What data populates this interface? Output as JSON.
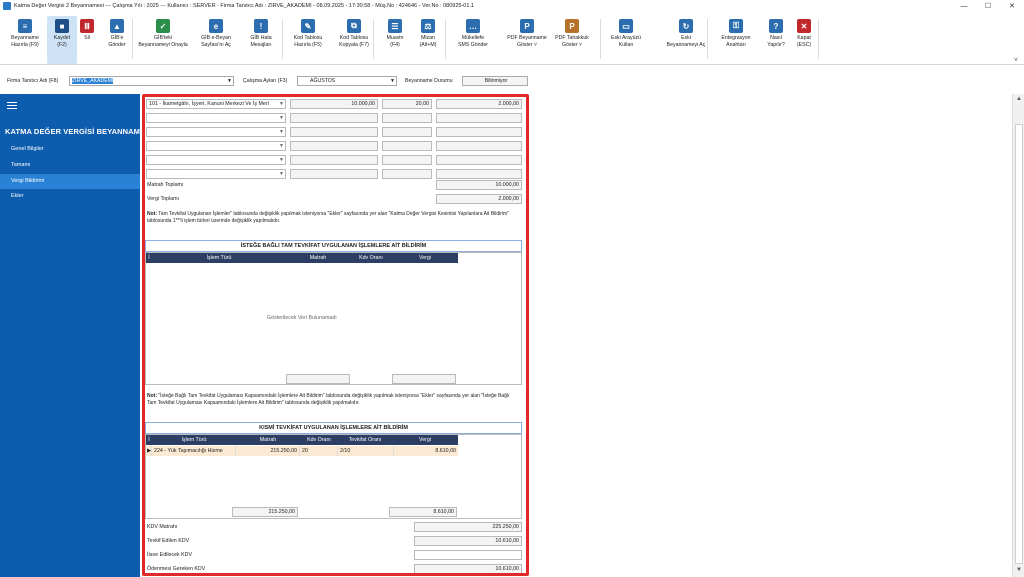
{
  "window": {
    "title": "Katma Değer Vergisi 2 Beyannamesi  ---  Çalışma Yılı : 2025  ---  Kullanıcı : SERVER - Firma Tanıtıcı Adı : ZIRVE_AKADEMI - 08.09.2025 - 17:30:58 - Müş.No : 424646 - Ver.No : 080925-01.1",
    "minimize": "—",
    "maximize": "☐",
    "close": "✕"
  },
  "toolbar": {
    "buttons": [
      {
        "label": "Beyanname\nHazırla (F9)",
        "color": "#2c6db0",
        "glyph": "≡"
      },
      {
        "label": "Kaydet\n(F2)",
        "color": "#1d4f86",
        "glyph": "■"
      },
      {
        "label": "Sil",
        "color": "#c0282d",
        "glyph": "Ⅲ"
      },
      {
        "label": "GİB'e\nGönder",
        "color": "#2c6db0",
        "glyph": "▲"
      },
      {
        "label": "GİB'teki\nBeyannameyi Onayla",
        "color": "#2b8f4b",
        "glyph": "✓"
      },
      {
        "label": "GİB e-Beyan\nSayfası'nı Aç",
        "color": "#2c6db0",
        "glyph": "e"
      },
      {
        "label": "GİB Hata\nMesajları",
        "color": "#2c6db0",
        "glyph": "!"
      },
      {
        "label": "Kod Tablosu\nHazırla (F5)",
        "color": "#2c6db0",
        "glyph": "✎"
      },
      {
        "label": "Kod Tablosu\nKopyala (F7)",
        "color": "#2c6db0",
        "glyph": "⧉"
      },
      {
        "label": "Muavin\n(F4)",
        "color": "#2c6db0",
        "glyph": "☰"
      },
      {
        "label": "Mizan\n(Alt+M)",
        "color": "#2c6db0",
        "glyph": "⚖"
      },
      {
        "label": "Mükellefe\nSMS Gönder",
        "color": "#2c6db0",
        "glyph": "…"
      },
      {
        "label": "PDF Beyanname\nGöster ˅",
        "color": "#2c6db0",
        "glyph": "P"
      },
      {
        "label": "PDF Tahakkuk\nGöster ˅",
        "color": "#b5702a",
        "glyph": "P"
      },
      {
        "label": "Eski Arayüzü\nKullan",
        "color": "#2c6db0",
        "glyph": "▭"
      },
      {
        "label": "Eski\nBeyannameyi Aç",
        "color": "#2c6db0",
        "glyph": "↻"
      },
      {
        "label": "Entegrasyon\nAnahtarı",
        "color": "#2c6db0",
        "glyph": "⚿"
      },
      {
        "label": "Nasıl\nYapılır?",
        "color": "#2c6db0",
        "glyph": "?"
      },
      {
        "label": "Kapat\n(ESC)",
        "color": "#c0282d",
        "glyph": "✕"
      }
    ],
    "collapse": "˅"
  },
  "filters": {
    "firma_label": "Firma Tanıtıcı Adı (F8)",
    "firma_value": "ZIRVE_AKADEMI",
    "ay_label": "Çalışma Ayları (F3)",
    "ay_value": "AĞUSTOS",
    "durum_label": "Beyanname Durumu",
    "durum_value": "Bilinmiyor"
  },
  "sidebar": {
    "title": "KATMA  DEĞER VERGİSİ BEYANNAM...",
    "items": [
      "Genel Bilgiler",
      "Tamamı",
      "Vergi Bildirimi",
      "Ekler"
    ]
  },
  "matrah_rows": [
    {
      "tur": "101 - İkametgâhı, İşyeri, Kanuni Merkezi Ve İş Merl",
      "matrah": "10.000,00",
      "oran": "20,00",
      "vergi": "2.000,00"
    },
    {
      "tur": "",
      "matrah": "",
      "oran": "",
      "vergi": ""
    },
    {
      "tur": "",
      "matrah": "",
      "oran": "",
      "vergi": ""
    },
    {
      "tur": "",
      "matrah": "",
      "oran": "",
      "vergi": ""
    },
    {
      "tur": "",
      "matrah": "",
      "oran": "",
      "vergi": ""
    },
    {
      "tur": "",
      "matrah": "",
      "oran": "",
      "vergi": ""
    }
  ],
  "totals1": {
    "matrah_label": "Matrah Toplamı",
    "matrah_value": "10.000,00",
    "vergi_label": "Vergi Toplamı",
    "vergi_value": "2.000,00"
  },
  "note1": {
    "prefix": "Not:",
    "text": " Tam Tevkifat Uygulanan İşlemler\" tablosunda değişiklik yapılmak isteniyorsa \"Ekler\" sayfasında yer alan \"Katma Değer Vergisi Kesintisi Yapılanlara Ait Bildirim\" tablosunda 1**'li işlem türleri üzerinde değişiklik yapılmalıdır."
  },
  "section1": {
    "title": "İSTEĞE BAĞLI TAM TEVKİFAT UYGULANAN İŞLEMLERE AİT BİLDİRİM",
    "columns": [
      "İ",
      "İşlem Türü",
      "Matrah",
      "Kdv Oranı",
      "Vergi"
    ],
    "empty": "Gösterilecek Veri Bulunamadı"
  },
  "note2": {
    "prefix": "Not:",
    "text": " \"İsteğe Bağlı Tam Tevkifat Uygulaması Kapsamındaki İşlemlere Ait Bildirim\" tablosunda değişiklik yapılmak isteniyorsa \"Ekler\" sayfasında yer alan \"İsteğe Bağlı Tam Tevkifat Uygulaması Kapsamındaki İşlemlere Ait Bildirim\" tablosunda değişiklik yapılmalıdır."
  },
  "section2": {
    "title": "KISMİ TEVKİFAT UYGULANAN İŞLEMLERE AİT BİLDİRİM",
    "columns": [
      "İ",
      "İşlem Türü",
      "Matrah",
      "Kdv Oranı",
      "Tevkifat Oranı",
      "Vergi"
    ],
    "row": {
      "marker": "▶",
      "tur": "224 - Yük Taşımacılığı Hizme",
      "matrah": "215.250,00",
      "oran": "20",
      "tevkifat": "2/10",
      "vergi": "8.610,00"
    },
    "foot_matrah": "215.250,00",
    "foot_vergi": "8.610,00"
  },
  "summary": [
    {
      "label": "KDV Matrahı",
      "value": "225.250,00"
    },
    {
      "label": "Tevkif Edilen KDV",
      "value": "10.610,00"
    },
    {
      "label": "İlave Edilecek KDV",
      "value": ""
    },
    {
      "label": "Ödenmesi Gereken KDV",
      "value": "10.610,00"
    }
  ]
}
